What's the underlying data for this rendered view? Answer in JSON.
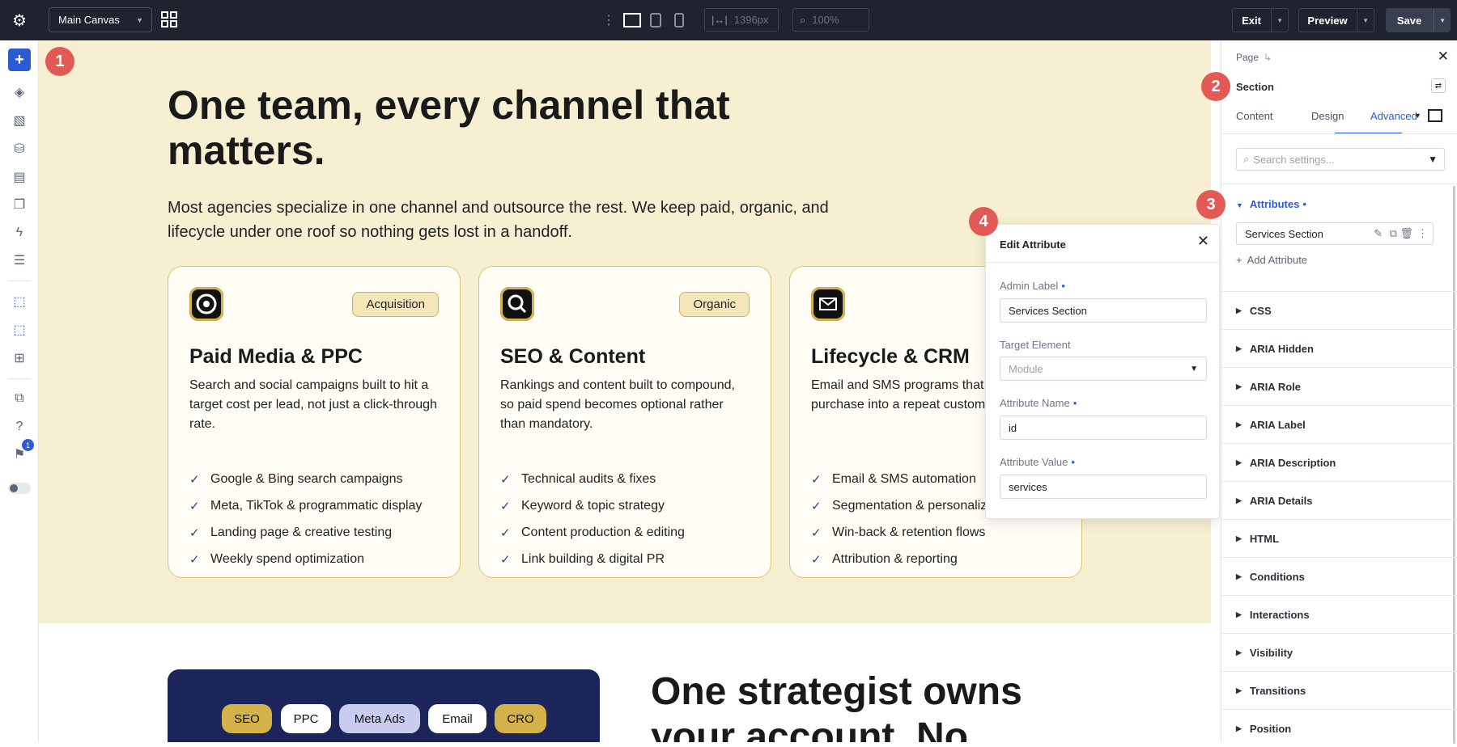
{
  "topbar": {
    "canvas_select": "Main Canvas",
    "width_value": "1396px",
    "zoom_value": "100%",
    "exit": "Exit",
    "preview": "Preview",
    "save": "Save"
  },
  "hero": {
    "title_line1": "One team, every channel that",
    "title_line2": "matters.",
    "sub_line1": "Most agencies specialize in one channel and outsource the rest. We keep paid, organic, and",
    "sub_line2": "lifecycle under one roof so nothing gets lost in a handoff."
  },
  "cards": [
    {
      "tag": "Acquisition",
      "title": "Paid Media & PPC",
      "desc": "Search and social campaigns built to hit a target cost per lead, not just a click-through rate.",
      "items": [
        "Google & Bing search campaigns",
        "Meta, TikTok & programmatic display",
        "Landing page & creative testing",
        "Weekly spend optimization"
      ],
      "icon": "target-icon"
    },
    {
      "tag": "Organic",
      "title": "SEO & Content",
      "desc": "Rankings and content built to compound, so paid spend becomes optional rather than mandatory.",
      "items": [
        "Technical audits & fixes",
        "Keyword & topic strategy",
        "Content production & editing",
        "Link building & digital PR"
      ],
      "icon": "search-icon"
    },
    {
      "tag": "",
      "title": "Lifecycle & CRM",
      "desc": "Email and SMS programs that purchase into a repeat custom",
      "items": [
        "Email & SMS automation",
        "Segmentation & personaliz",
        "Win-back & retention flows",
        "Attribution & reporting"
      ],
      "icon": "mail-icon"
    }
  ],
  "lower": {
    "pills": [
      "SEO",
      "PPC",
      "Meta Ads",
      "Email",
      "CRO"
    ],
    "heading_line1": "One strategist owns",
    "heading_line2": "your account. No"
  },
  "popup": {
    "title": "Edit Attribute",
    "admin_label": "Admin Label",
    "admin_value": "Services Section",
    "target_label": "Target Element",
    "target_placeholder": "Module",
    "name_label": "Attribute Name",
    "name_value": "id",
    "value_label": "Attribute Value",
    "value_value": "services"
  },
  "panel": {
    "breadcrumb": "Page",
    "section": "Section",
    "tabs": [
      "Content",
      "Design",
      "Advanced"
    ],
    "search_placeholder": "Search settings...",
    "attributes": "Attributes",
    "attribute_item": "Services Section",
    "add_attribute": "Add Attribute",
    "groups": [
      "CSS",
      "ARIA Hidden",
      "ARIA Role",
      "ARIA Label",
      "ARIA Description",
      "ARIA Details",
      "HTML",
      "Conditions",
      "Interactions",
      "Visibility",
      "Transitions",
      "Position"
    ]
  },
  "badges": [
    "1",
    "2",
    "3",
    "4"
  ],
  "sidebar": {
    "notification_count": "1"
  },
  "colors": {
    "accent": "#2c5bd6",
    "hero_bg": "#f6efd2",
    "badge": "#e25a55",
    "dark_block": "#1b2559"
  }
}
